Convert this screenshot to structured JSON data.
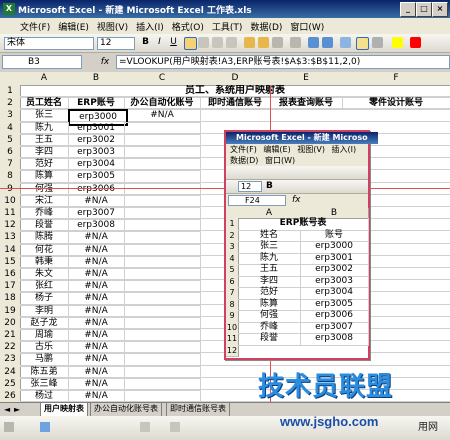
{
  "window": {
    "title": "Microsoft Excel - 新建 Microsoft Excel 工作表.xls"
  },
  "menu": [
    "文件(F)",
    "编辑(E)",
    "视图(V)",
    "插入(I)",
    "格式(O)",
    "工具(T)",
    "数据(D)",
    "窗口(W)"
  ],
  "format_bar": {
    "font": "宋体",
    "size": "12"
  },
  "name_box": "B3",
  "formula": "=VLOOKUP(用户映射表!A3,ERP账号表!$A$3:$B$11,2,0)",
  "columns": [
    "A",
    "B",
    "C",
    "D",
    "E",
    "F"
  ],
  "sheet_title": "员工、系统用户映射表",
  "headers": [
    "员工姓名",
    "ERP账号",
    "办公自动化账号",
    "即时通信账号",
    "报表查询账号",
    "零件设计账号"
  ],
  "rows": [
    [
      "张三",
      "erp3000",
      "#N/A"
    ],
    [
      "陈九",
      "erp3001",
      ""
    ],
    [
      "王五",
      "erp3002",
      ""
    ],
    [
      "李四",
      "erp3003",
      ""
    ],
    [
      "范好",
      "erp3004",
      ""
    ],
    [
      "陈算",
      "erp3005",
      ""
    ],
    [
      "何强",
      "erp3006",
      ""
    ],
    [
      "宋江",
      "#N/A",
      ""
    ],
    [
      "乔峰",
      "erp3007",
      ""
    ],
    [
      "段誉",
      "erp3008",
      ""
    ],
    [
      "陈腾",
      "#N/A",
      ""
    ],
    [
      "何花",
      "#N/A",
      ""
    ],
    [
      "韩秉",
      "#N/A",
      ""
    ],
    [
      "朱文",
      "#N/A",
      ""
    ],
    [
      "张红",
      "#N/A",
      ""
    ],
    [
      "杨子",
      "#N/A",
      ""
    ],
    [
      "李明",
      "#N/A",
      ""
    ],
    [
      "赵子龙",
      "#N/A",
      ""
    ],
    [
      "周瑜",
      "#N/A",
      ""
    ],
    [
      "古乐",
      "#N/A",
      ""
    ],
    [
      "马鹏",
      "#N/A",
      ""
    ],
    [
      "陈五弟",
      "#N/A",
      ""
    ],
    [
      "张三峰",
      "#N/A",
      ""
    ],
    [
      "杨过",
      "#N/A",
      ""
    ],
    [
      "智玉",
      "#N/A",
      ""
    ]
  ],
  "row_numbers": [
    "1",
    "2",
    "3",
    "4",
    "5",
    "6",
    "7",
    "8",
    "9",
    "10",
    "11",
    "12",
    "13",
    "14",
    "15",
    "16",
    "17",
    "18",
    "19",
    "20",
    "21",
    "22",
    "23",
    "24",
    "25",
    "26",
    "27"
  ],
  "inner_window": {
    "title": "Microsoft Excel - 新建 Microso",
    "menu1": [
      "文件(F)",
      "编辑(E)",
      "视图(V)",
      "插入(I)"
    ],
    "menu2": [
      "数据(D)",
      "窗口(W)"
    ],
    "font_size": "12",
    "name_box": "F24",
    "columns": [
      "A",
      "B"
    ],
    "title_row": "ERP账号表",
    "headers": [
      "姓名",
      "账号"
    ],
    "rows": [
      [
        "张三",
        "erp3000"
      ],
      [
        "陈九",
        "erp3001"
      ],
      [
        "王五",
        "erp3002"
      ],
      [
        "李四",
        "erp3003"
      ],
      [
        "范好",
        "erp3004"
      ],
      [
        "陈算",
        "erp3005"
      ],
      [
        "何强",
        "erp3006"
      ],
      [
        "乔峰",
        "erp3007"
      ],
      [
        "段誉",
        "erp3008"
      ]
    ],
    "row_numbers": [
      "1",
      "2",
      "3",
      "4",
      "5",
      "6",
      "7",
      "8",
      "9",
      "10",
      "11",
      "12"
    ]
  },
  "tabs": [
    "用户映射表",
    "办公自动化账号表",
    "即时通信账号表"
  ],
  "watermark": {
    "main": "技术员联盟",
    "url": "www.jsgho.com",
    "suffix": "用网"
  },
  "colors": {
    "title_bar": "#0a246a",
    "selection": "#000000",
    "highlight_border": "#d04060",
    "watermark": "#2a8de0"
  }
}
